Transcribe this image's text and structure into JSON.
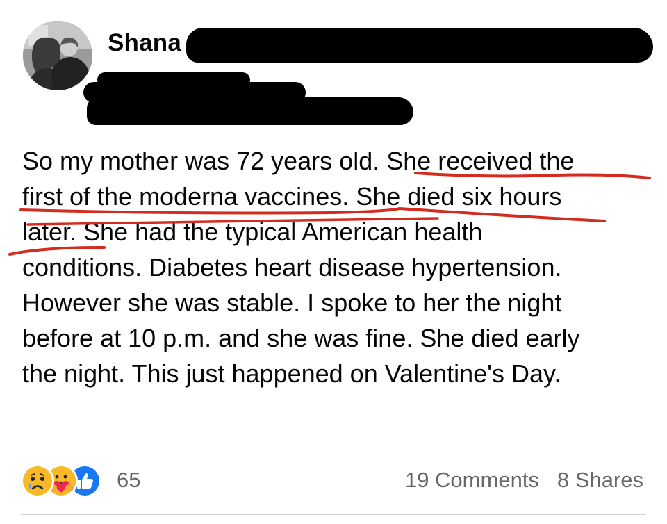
{
  "post": {
    "author_name": "Shana",
    "avatar_icon": "profile-photo-avatar",
    "body_lines": [
      "So my mother was 72 years old.  She received the",
      "first of the moderna vaccines. She died six hours",
      "later. She had the typical American health",
      "conditions. Diabetes heart disease hypertension.",
      "However she was stable. I spoke to her the night",
      "before at 10 p.m. and she was fine. She died early",
      "the night. This just happened on Valentine's Day."
    ],
    "annotation_color": "#d22b1f"
  },
  "footer": {
    "reactions": [
      {
        "name": "sad-reaction-icon",
        "color": "#f7b928"
      },
      {
        "name": "care-reaction-icon",
        "color": "#f7b928"
      },
      {
        "name": "like-reaction-icon",
        "color": "#1877f2"
      }
    ],
    "reaction_count": "65",
    "comments": "19 Comments",
    "shares": "8 Shares"
  }
}
